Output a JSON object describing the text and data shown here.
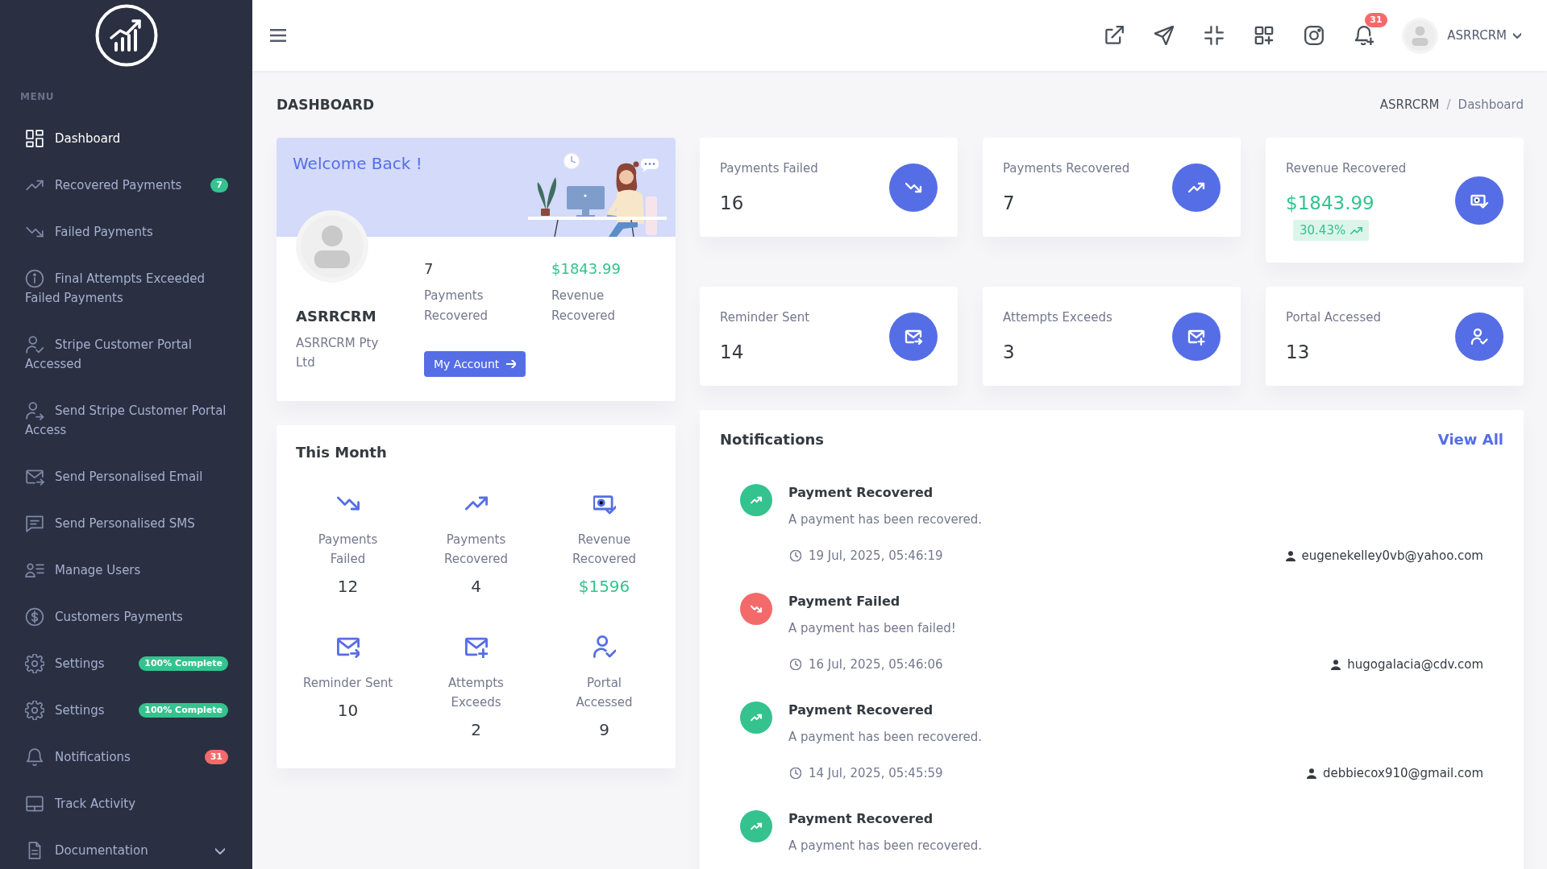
{
  "sidebar": {
    "menu_heading": "MENU",
    "items": [
      {
        "label": "Dashboard",
        "selected": true
      },
      {
        "label": "Recovered Payments",
        "selected": false,
        "badge": {
          "text": "7",
          "color": "#34c38f"
        }
      },
      {
        "label": "Failed Payments",
        "selected": false
      },
      {
        "label": "Final Attempts Exceeded Failed Payments",
        "selected": false
      },
      {
        "label": "Stripe Customer Portal Accessed",
        "selected": false
      },
      {
        "label": "Send Stripe Customer Portal Access",
        "selected": false
      },
      {
        "label": "Send Personalised Email",
        "selected": false
      },
      {
        "label": "Send Personalised SMS",
        "selected": false
      },
      {
        "label": "Manage Users",
        "selected": false
      },
      {
        "label": "Customers Payments",
        "selected": false
      },
      {
        "label": "Settings",
        "selected": false,
        "badge": {
          "text": "100% Complete",
          "color": "#34c38f"
        }
      },
      {
        "label": "Settings",
        "selected": false,
        "badge": {
          "text": "100% Complete",
          "color": "#34c38f"
        }
      },
      {
        "label": "Notifications",
        "selected": false,
        "badge": {
          "text": "31",
          "color": "#f46a6a"
        }
      },
      {
        "label": "Track Activity",
        "selected": false
      },
      {
        "label": "Documentation",
        "selected": false,
        "expanded": false
      }
    ]
  },
  "topbar": {
    "notification_count": "31",
    "user_name": "ASRRCRM"
  },
  "page_header": {
    "title": "DASHBOARD",
    "separator": "/",
    "breadcrumb": [
      {
        "label": "ASRRCRM",
        "active": false
      },
      {
        "label": "Dashboard",
        "active": true
      }
    ]
  },
  "welcome_card": {
    "title": "Welcome Back !",
    "name": "ASRRCRM",
    "company": "ASRRCRM Pty Ltd",
    "stats": [
      {
        "kind": "count",
        "value": "7",
        "label": "Payments Recovered"
      },
      {
        "kind": "revenue",
        "value": "$1843.99",
        "label": "Revenue Recovered"
      }
    ],
    "button": "My Account"
  },
  "this_month": {
    "title": "This Month",
    "items": [
      {
        "kind": "count",
        "label": "Payments Failed",
        "value": "12"
      },
      {
        "kind": "count",
        "label": "Payments Recovered",
        "value": "4"
      },
      {
        "kind": "revenue",
        "label": "Revenue Recovered",
        "value": "$1596"
      },
      {
        "kind": "count",
        "label": "Reminder Sent",
        "value": "10"
      },
      {
        "kind": "count",
        "label": "Attempts Exceeds",
        "value": "2"
      },
      {
        "kind": "count",
        "label": "Portal Accessed",
        "value": "9"
      }
    ]
  },
  "stat_cards": [
    {
      "kind": "count",
      "title": "Payments Failed",
      "value": "16"
    },
    {
      "kind": "count",
      "title": "Payments Recovered",
      "value": "7"
    },
    {
      "kind": "revenue",
      "title": "Revenue Recovered",
      "value": "$1843.99",
      "change": "30.43%"
    },
    {
      "kind": "count",
      "title": "Reminder Sent",
      "value": "14"
    },
    {
      "kind": "count",
      "title": "Attempts Exceeds",
      "value": "3"
    },
    {
      "kind": "count",
      "title": "Portal Accessed",
      "value": "13"
    }
  ],
  "notifications": {
    "title": "Notifications",
    "link": "View All",
    "items": [
      {
        "kind": "recovered",
        "title": "Payment Recovered",
        "message": "A payment has been recovered.",
        "time": "19 Jul, 2025, 05:46:19",
        "email": "eugenekelley0vb@yahoo.com"
      },
      {
        "kind": "failed",
        "title": "Payment Failed",
        "message": "A payment has been failed!",
        "time": "16 Jul, 2025, 05:46:06",
        "email": "hugogalacia@cdv.com"
      },
      {
        "kind": "recovered",
        "title": "Payment Recovered",
        "message": "A payment has been recovered.",
        "time": "14 Jul, 2025, 05:45:59",
        "email": "debbiecox910@gmail.com"
      },
      {
        "kind": "recovered",
        "title": "Payment Recovered",
        "message": "A payment has been recovered."
      }
    ]
  }
}
